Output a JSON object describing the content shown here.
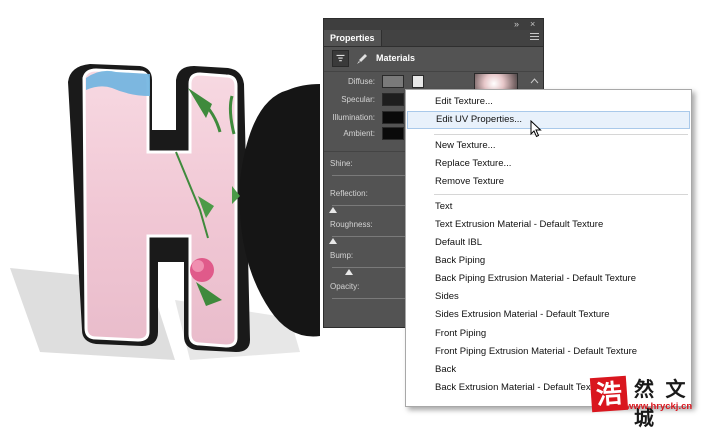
{
  "panel": {
    "title": "Properties",
    "collapse_icon": "double-chevron-icon",
    "close_icon": "close-icon",
    "menu_icon": "panel-menu-icon",
    "section_label": "Materials",
    "properties": {
      "diffuse": "Diffuse:",
      "specular": "Specular:",
      "illumination": "Illumination:",
      "ambient": "Ambient:"
    },
    "sliders": {
      "shine": "Shine:",
      "reflection": "Reflection:",
      "roughness": "Roughness:",
      "bump": "Bump:",
      "opacity": "Opacity:"
    }
  },
  "menu": {
    "group1": [
      "Edit Texture...",
      "Edit UV Properties..."
    ],
    "group2": [
      "New Texture...",
      "Replace Texture...",
      "Remove Texture"
    ],
    "group3": [
      "Text",
      "Text Extrusion Material - Default Texture",
      "Default IBL",
      "Back Piping",
      "Back Piping Extrusion Material - Default Texture",
      "Sides",
      "Sides Extrusion Material - Default Texture",
      "Front Piping",
      "Front Piping Extrusion Material - Default Texture",
      "Back",
      "Back Extrusion Material - Default Texture"
    ]
  },
  "artwork": {
    "letters": "HO"
  },
  "watermark": {
    "seal": "浩",
    "text": "然 文 城",
    "url": "www.hryckj.cn"
  },
  "colors": {
    "panel_bg": "#535353",
    "menu_hover": "#e8f1fb",
    "watermark_red": "#d9161e",
    "letter_pink": "#f3cdd8"
  }
}
